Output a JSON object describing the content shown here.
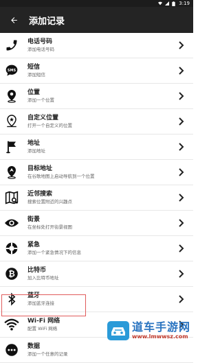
{
  "statusbar": {
    "time": "3:19"
  },
  "appbar": {
    "title": "添加记录"
  },
  "items": [
    {
      "title": "电话号码",
      "sub": "添加电话号码",
      "icon": "phone-icon"
    },
    {
      "title": "短信",
      "sub": "添加短信",
      "icon": "sms-icon"
    },
    {
      "title": "位置",
      "sub": "添加一个位置",
      "icon": "location-pin-icon"
    },
    {
      "title": "自定义位置",
      "sub": "打开一个自定义的位置",
      "icon": "custom-location-icon"
    },
    {
      "title": "地址",
      "sub": "添加地址",
      "icon": "flag-icon"
    },
    {
      "title": "目标地址",
      "sub": "在谷歌地图上启动导航到一个位置",
      "icon": "navigation-target-icon"
    },
    {
      "title": "近邻搜索",
      "sub": "搜索位置附近的兴趣点",
      "icon": "map-search-icon"
    },
    {
      "title": "街景",
      "sub": "在坐标处打开街景视图",
      "icon": "eye-icon"
    },
    {
      "title": "紧急",
      "sub": "添加一个紧急情况下的信息",
      "icon": "lifebuoy-icon"
    },
    {
      "title": "比特币",
      "sub": "加入比特币地址",
      "icon": "bitcoin-icon"
    },
    {
      "title": "蓝牙",
      "sub": "添加蓝牙连接",
      "icon": "bluetooth-icon"
    },
    {
      "title": "Wi-Fi 网络",
      "sub": "配置 WiFi 网络",
      "icon": "wifi-icon"
    },
    {
      "title": "数据",
      "sub": "添加一个任意的记录",
      "icon": "data-icon"
    }
  ],
  "watermark": {
    "cn": "道车手游网",
    "url": "www.lmwwsz.com"
  }
}
